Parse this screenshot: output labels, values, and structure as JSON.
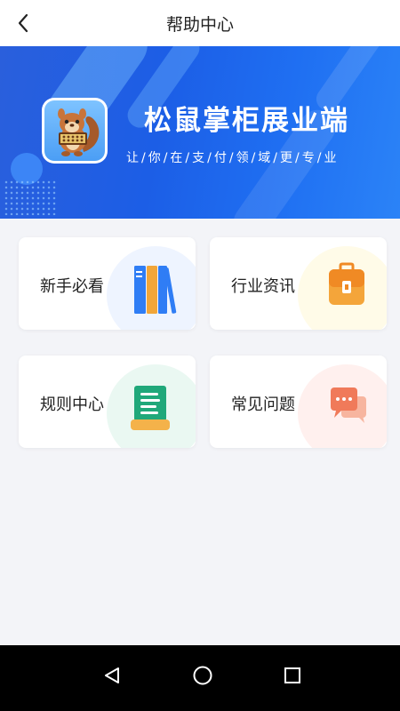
{
  "header": {
    "title": "帮助中心",
    "back_icon": "chevron-left-icon"
  },
  "banner": {
    "app_name": "松鼠掌柜展业端",
    "slogan": "让/你/在/支/付/领/域/更/专/业",
    "logo_icon": "squirrel-logo-icon"
  },
  "cards": [
    {
      "label": "新手必看",
      "icon": "books-icon",
      "accent": "#2f7df5"
    },
    {
      "label": "行业资讯",
      "icon": "briefcase-icon",
      "accent": "#f08a24"
    },
    {
      "label": "规则中心",
      "icon": "scroll-icon",
      "accent": "#20a87a"
    },
    {
      "label": "常见问题",
      "icon": "chat-bubbles-icon",
      "accent": "#f07a5a"
    }
  ],
  "navbar": {
    "back": "triangle-back-icon",
    "home": "circle-home-icon",
    "recents": "square-recents-icon"
  }
}
